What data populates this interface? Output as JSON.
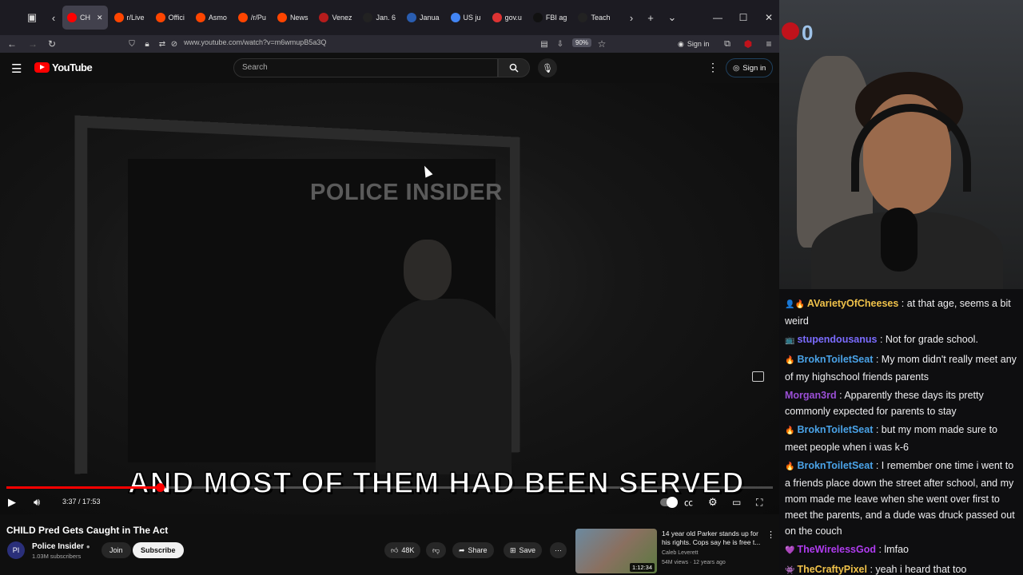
{
  "browser": {
    "tabs": [
      {
        "label": "CH",
        "active": true,
        "color": "#ff0000"
      },
      {
        "label": "r/Live",
        "color": "#ff4500"
      },
      {
        "label": "Offici",
        "color": "#ff4500"
      },
      {
        "label": "Asmo",
        "color": "#ff4500"
      },
      {
        "label": "/r/Pu",
        "color": "#ff4500"
      },
      {
        "label": "News",
        "color": "#ff4500"
      },
      {
        "label": "Venez",
        "color": "#b51c1c"
      },
      {
        "label": "Jan. 6",
        "color": "#222222"
      },
      {
        "label": "Janua",
        "color": "#2a5db0"
      },
      {
        "label": "US ju",
        "color": "#4285f4"
      },
      {
        "label": "gov.u",
        "color": "#d33"
      },
      {
        "label": "FBI ag",
        "color": "#111111"
      },
      {
        "label": "Teach",
        "color": "#222222"
      }
    ],
    "url": "www.youtube.com/watch?v=m6wmupB5a3Q",
    "zoom": "90%",
    "sign_in": "Sign in"
  },
  "youtube": {
    "logo_text": "YouTube",
    "search_placeholder": "Search",
    "sign_in": "Sign in"
  },
  "video": {
    "watermark": "POLICE INSIDER",
    "caption": "AND MOST OF THEM HAD BEEN SERVED",
    "time": "3:37 / 17:53",
    "progress": 0.2,
    "title": "CHILD Pred Gets Caught in The Act",
    "channel": "Police Insider",
    "subscribers": "1.03M subscribers",
    "join": "Join",
    "subscribe": "Subscribe",
    "likes": "48K",
    "share": "Share",
    "save": "Save"
  },
  "recommended": {
    "title": "14 year old Parker stands up for his rights. Cops say he is free t...",
    "channel": "Caleb Leverett",
    "meta": "54M views · 12 years ago",
    "duration": "1:12:34"
  },
  "webcam": {
    "badge_text": "0"
  },
  "chat": [
    {
      "badge": "👤🔥",
      "user": "AVarietyOfCheeses",
      "color": "#f0c24a",
      "text": "at that age, seems a bit weird"
    },
    {
      "badge": "📺",
      "user": "stupendousanus",
      "color": "#7b6cff",
      "text": "Not for grade school."
    },
    {
      "badge": "🔥",
      "user": "BroknToiletSeat",
      "color": "#4aa3e8",
      "text": "My mom didn't really meet any of my highschool friends parents"
    },
    {
      "badge": "",
      "user": "Morgan3rd",
      "color": "#9b4fd6",
      "text": "Apparently these days its pretty commonly expected for parents to stay"
    },
    {
      "badge": "🔥",
      "user": "BroknToiletSeat",
      "color": "#4aa3e8",
      "text": "but my mom made sure to meet people when i was k-6"
    },
    {
      "badge": "🔥",
      "user": "BroknToiletSeat",
      "color": "#4aa3e8",
      "text": "I remember one time i went to a friends place down the street after school, and my mom made me leave when she went over first to meet the parents, and a dude was druck passed out on the couch"
    },
    {
      "badge": "💜",
      "user": "TheWirelessGod",
      "color": "#b03cf0",
      "text": "lmfao"
    },
    {
      "badge": "👾",
      "user": "TheCraftyPixel",
      "color": "#f0c24a",
      "text": "yeah i heard that too"
    }
  ]
}
